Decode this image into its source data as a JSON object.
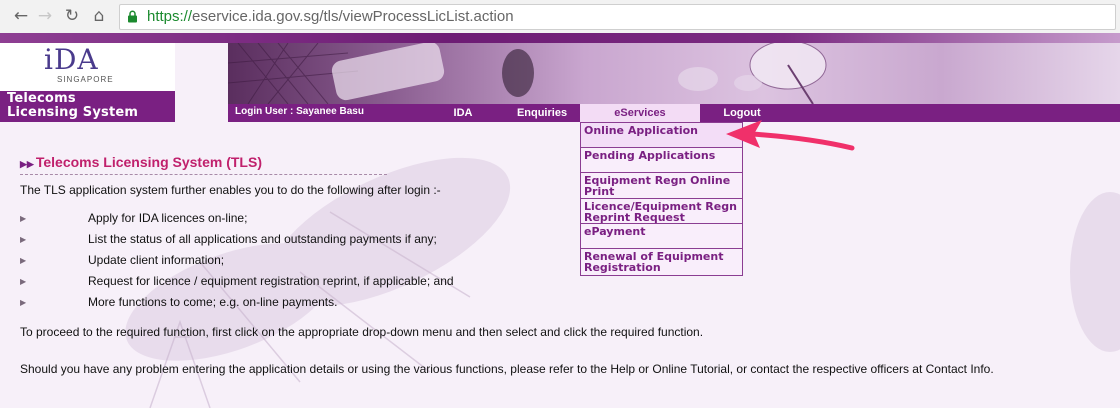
{
  "browser": {
    "url_scheme": "https://",
    "url_rest": "eservice.ida.gov.sg/tls/viewProcessLicList.action",
    "back_icon": "back-arrow-icon",
    "forward_icon": "forward-arrow-icon",
    "reload_icon": "reload-icon",
    "home_icon": "home-icon",
    "lock_icon": "lock-icon"
  },
  "header": {
    "logo_text": "iDA",
    "logo_sub": "SINGAPORE",
    "system_title_line1": "Telecoms",
    "system_title_line2": "Licensing System"
  },
  "menubar": {
    "login_user": "Login User : Sayanee Basu",
    "items": [
      "IDA",
      "Enquiries",
      "eServices",
      "Logout"
    ],
    "active": "eServices"
  },
  "dropdown": {
    "items": [
      "Online Application",
      "Pending Applications",
      "Equipment Regn Online Print",
      "Licence/Equipment Regn Reprint Request",
      "ePayment",
      "Renewal of Equipment Registration"
    ]
  },
  "content": {
    "title": "Telecoms Licensing System (TLS)",
    "intro": "The TLS application system further enables you to do the following after login :-",
    "bullets": [
      "Apply for IDA licences on-line;",
      "List the status of all applications and outstanding payments if any;",
      "Update client information;",
      "Request for licence / equipment registration reprint, if applicable; and",
      "More functions to come; e.g. on-line payments."
    ],
    "para1": "To proceed to the required function, first click on the appropriate drop-down menu and then select and click the required function.",
    "para2": "Should you have any problem entering the application details or using the various functions, please refer to the Help or Online Tutorial, or contact the respective officers at Contact Info."
  },
  "colors": {
    "brand_purple": "#7a2082",
    "title_magenta": "#c0206c",
    "annotation_arrow": "#f0306a"
  }
}
